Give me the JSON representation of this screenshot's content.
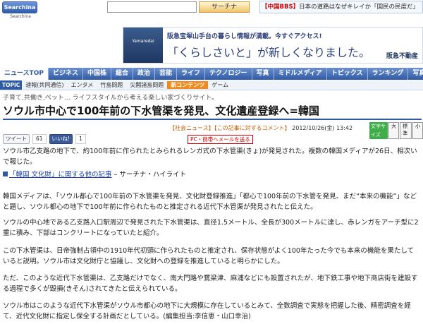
{
  "header": {
    "logo_text": "Searchina",
    "logo_sub": "Searchina",
    "search_button": "サーチナ",
    "ticker_tag": "【中国BBS】",
    "ticker_text": "日本の道路はなぜキレイか「国民の民度だ」"
  },
  "banner": {
    "left_text": "Yamaredai",
    "line1": "阪急宝塚山手台の暮らし情報が満載。今すぐアクセス!",
    "line2": "「くらしさいと」が新しくなりました。",
    "brand": "阪急不動産"
  },
  "nav": {
    "items": [
      "ニュースTOP",
      "ビジネス",
      "中国株",
      "総合",
      "政治",
      "芸能",
      "ライフ",
      "テクノロジー",
      "写真",
      "ミドルメディア",
      "トピックス",
      "ランキング",
      "写真"
    ]
  },
  "subnav": {
    "topic_label": "TOPIC",
    "items": [
      "速報(共同通信)",
      "エンタメ",
      "竹島問題",
      "尖閣諸島問題",
      "新コンテンツ",
      "ゲーム"
    ]
  },
  "catchcopy": "子育て,共働き,ペット… ライフスタイルから考える楽しい家づくりサイト。",
  "article": {
    "headline": "ソウル市中心で100年前の下水管渠を発見、文化遺産登録へ=韓国",
    "category": "【社会ニュース】",
    "comment_link": "【この記事に対するコメント】",
    "datetime": "2012/10/26(金) 13:42",
    "size_label": "文字サイズ",
    "sizes": [
      "大",
      "標準",
      "小"
    ],
    "tweet_label": "ツイート",
    "tweet_count": "61",
    "like_label": "いいね!",
    "like_count": "1",
    "pc_label": "PC・携帯へメールを送る",
    "p1": "ソウル市乙支路の地下で、約100年前に作られたとみられるレンガ式の下水管渠(きょ)が発見された。複数の韓国メディアが26日、相次いで報じた。",
    "related_link": "「韓国 文化財」に関する他の記事",
    "related_suffix": " – サーチナ・ハイライト",
    "p2": "韓国メディアは、「ソウル都心で100年前の下水管渠を発見、文化財登録推進」「都心で100年前の下水管を発見、まだ“本来の機能”」などと題し、ソウル都心の地下で100年前に作られたものと推定される近代下水管渠が発見されたと伝えた。",
    "p3": "ソウルの中心地である乙支路入口駅周辺で発見された下水管渠は、直径1.5メートル、全長が300メートルに達し、赤レンガをアーチ型に2重に積み、下部はコンクリートになっていたと紹介。",
    "p4": "この下水管渠は、日帝強制占領中の1910年代初頭に作られたものと推定され、保存状態がよく100年たった今でも本来の機能を果たしていると説明。ソウル市は文化財庁と協議し、文化財への登録を推進していると明らかにした。",
    "p5": "ただ、このような近代下水管渠は、乙支路だけでなく、南大門路や鷺梁津、麻浦などにも設置されたが、地下鉄工事や地下商店街を建設する過程で多くが毀損(きそん)されてきたと伝えられている。",
    "p6": "ソウル市はこのような近代下水管渠がソウル市都心の地下に大規模に存在しているとみて、全数調査で実態を把握した後、精密調査を経て、近代文化財に指定し保全する計画だとしている。(編集担当:李信恵・山口幸治)"
  }
}
